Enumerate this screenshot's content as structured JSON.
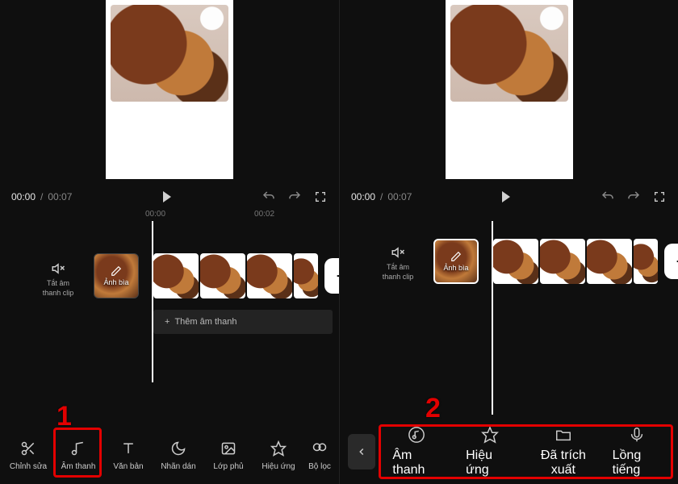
{
  "player": {
    "current": "00:00",
    "sep": " / ",
    "total": "00:07"
  },
  "ruler": {
    "t0": "00:00",
    "t1": "00:02"
  },
  "muteclip": {
    "line1_a": "Tắt âm",
    "line2_a": "thanh clip",
    "line1_b": "Tắt âm",
    "line2_b": "thanh clip"
  },
  "cover_label": "Ảnh bìa",
  "add_audio": "Thêm âm thanh",
  "step1": "1",
  "step2": "2",
  "toolbar_a": {
    "edit": "Chỉnh sửa",
    "audio": "Âm thanh",
    "text": "Văn bản",
    "sticker": "Nhãn dán",
    "overlay": "Lớp phủ",
    "effects": "Hiệu ứng",
    "filter": "Bộ lọc"
  },
  "toolbar_b": {
    "audio": "Âm thanh",
    "effects": "Hiệu ứng",
    "extracted": "Đã trích xuất",
    "voice": "Lồng tiếng"
  }
}
